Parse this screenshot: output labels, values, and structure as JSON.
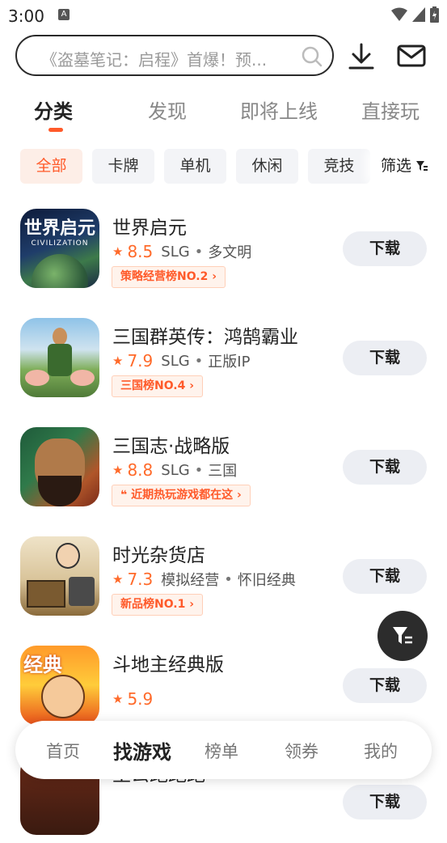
{
  "status": {
    "time": "3:00",
    "a_icon": "A"
  },
  "search": {
    "placeholder": "《盗墓笔记：启程》首爆！预..."
  },
  "tabs": [
    {
      "label": "分类"
    },
    {
      "label": "发现"
    },
    {
      "label": "即将上线"
    },
    {
      "label": "直接玩"
    }
  ],
  "chips": [
    {
      "label": "全部"
    },
    {
      "label": "卡牌"
    },
    {
      "label": "单机"
    },
    {
      "label": "休闲"
    },
    {
      "label": "竞技"
    }
  ],
  "filter_label": "筛选",
  "games": [
    {
      "name": "世界启元",
      "score": "8.5",
      "tag1": "SLG",
      "tag2": "多文明",
      "badge": "策略经营榜NO.2 ›",
      "download": "下载"
    },
    {
      "name": "三国群英传：鸿鹄霸业",
      "score": "7.9",
      "tag1": "SLG",
      "tag2": "正版IP",
      "badge": "三国榜NO.4 ›",
      "download": "下载"
    },
    {
      "name": "三国志·战略版",
      "score": "8.8",
      "tag1": "SLG",
      "tag2": "三国",
      "badge": "❝ 近期热玩游戏都在这 ›",
      "download": "下载"
    },
    {
      "name": "时光杂货店",
      "score": "7.3",
      "tag1": "模拟经营",
      "tag2": "怀旧经典",
      "badge": "新品榜NO.1 ›",
      "download": "下载"
    },
    {
      "name": "斗地主经典版",
      "score": "5.9",
      "download": "下载"
    },
    {
      "name": "主公跑跑跑",
      "download": "下载"
    }
  ],
  "icon_text": {
    "game1": "世界启元",
    "game1_sub": "CIVILIZATION",
    "game5": "经典"
  },
  "bottom_nav": [
    {
      "label": "首页"
    },
    {
      "label": "找游戏"
    },
    {
      "label": "榜单"
    },
    {
      "label": "领券"
    },
    {
      "label": "我的"
    }
  ],
  "colors": {
    "accent": "#ff5a2a",
    "chip_bg": "#f3f4f7",
    "button_bg": "#eceef3"
  }
}
